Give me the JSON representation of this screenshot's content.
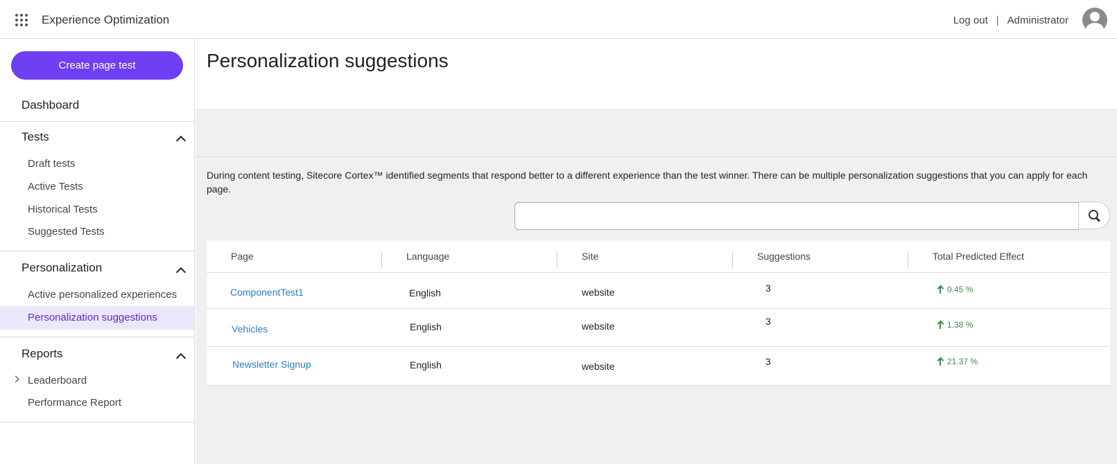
{
  "header": {
    "app_title": "Experience Optimization",
    "logout": "Log out",
    "separator": "|",
    "user": "Administrator"
  },
  "sidebar": {
    "create_button": "Create page test",
    "dashboard": "Dashboard",
    "tests": {
      "heading": "Tests",
      "items": [
        "Draft tests",
        "Active Tests",
        "Historical Tests",
        "Suggested Tests"
      ]
    },
    "personalization": {
      "heading": "Personalization",
      "items": [
        "Active personalized experiences",
        "Personalization suggestions"
      ]
    },
    "reports": {
      "heading": "Reports",
      "items": [
        "Leaderboard",
        "Performance Report"
      ]
    }
  },
  "main": {
    "title": "Personalization suggestions",
    "description": "During content testing, Sitecore Cortex™ identified segments that respond better to a different experience than the test winner. There can be multiple personalization suggestions that you can apply for each page.",
    "search": {
      "value": "",
      "placeholder": ""
    },
    "table": {
      "columns": [
        "Page",
        "Language",
        "Site",
        "Suggestions",
        "Total Predicted Effect"
      ],
      "rows": [
        {
          "page": "ComponentTest1",
          "language": "English",
          "site": "website",
          "suggestions": "3",
          "effect": "0.45 %"
        },
        {
          "page": "Vehicles",
          "language": "English",
          "site": "website",
          "suggestions": "3",
          "effect": "1.38 %"
        },
        {
          "page": "Newsletter Signup",
          "language": "English",
          "site": "website",
          "suggestions": "3",
          "effect": "21.37 %"
        }
      ]
    }
  },
  "colors": {
    "accent": "#6e3ff3",
    "link": "#2a7fc0",
    "positive": "#3a8a4a",
    "active_bg": "#ece8fb"
  }
}
